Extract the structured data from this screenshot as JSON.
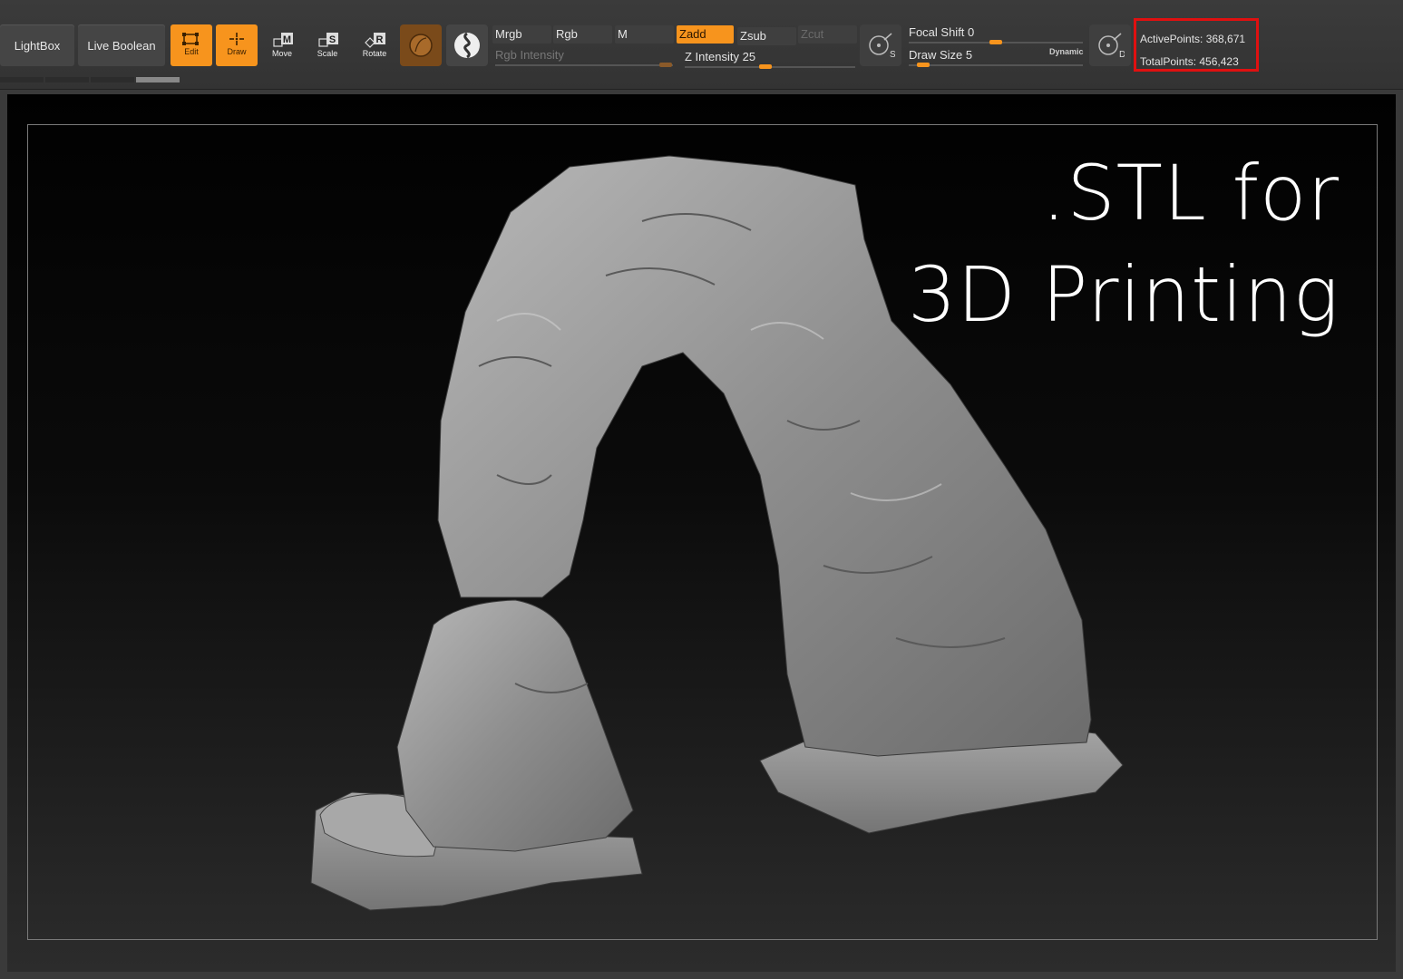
{
  "toolbar": {
    "lightbox": "LightBox",
    "live_boolean": "Live Boolean",
    "tools": {
      "edit": {
        "label": "Edit",
        "icon": "edit-icon"
      },
      "draw": {
        "label": "Draw",
        "icon": "draw-icon"
      },
      "move": {
        "label": "Move",
        "key": "M"
      },
      "scale": {
        "label": "Scale",
        "key": "S"
      },
      "rotate": {
        "label": "Rotate",
        "key": "R"
      }
    },
    "modes": {
      "mrgb": "Mrgb",
      "rgb": "Rgb",
      "m": "M",
      "zadd": "Zadd",
      "zsub": "Zsub",
      "zcut": "Zcut"
    },
    "rgb_intensity": {
      "label": "Rgb Intensity"
    },
    "z_intensity": {
      "label": "Z Intensity",
      "value": "25"
    },
    "focal_shift": {
      "label": "Focal Shift",
      "value": "0"
    },
    "draw_size": {
      "label": "Draw Size",
      "value": "5"
    },
    "dynamic": "Dynamic",
    "lazy_s_key": "S",
    "lazy_d_key": "D",
    "accent_color": "#f7941d"
  },
  "stats": {
    "active_points": "ActivePoints: 368,671",
    "total_points": "TotalPoints: 456,423",
    "highlight_color": "#e01010"
  },
  "viewport": {
    "caption_line1": ".STL for",
    "caption_line2": "3D Printing"
  }
}
